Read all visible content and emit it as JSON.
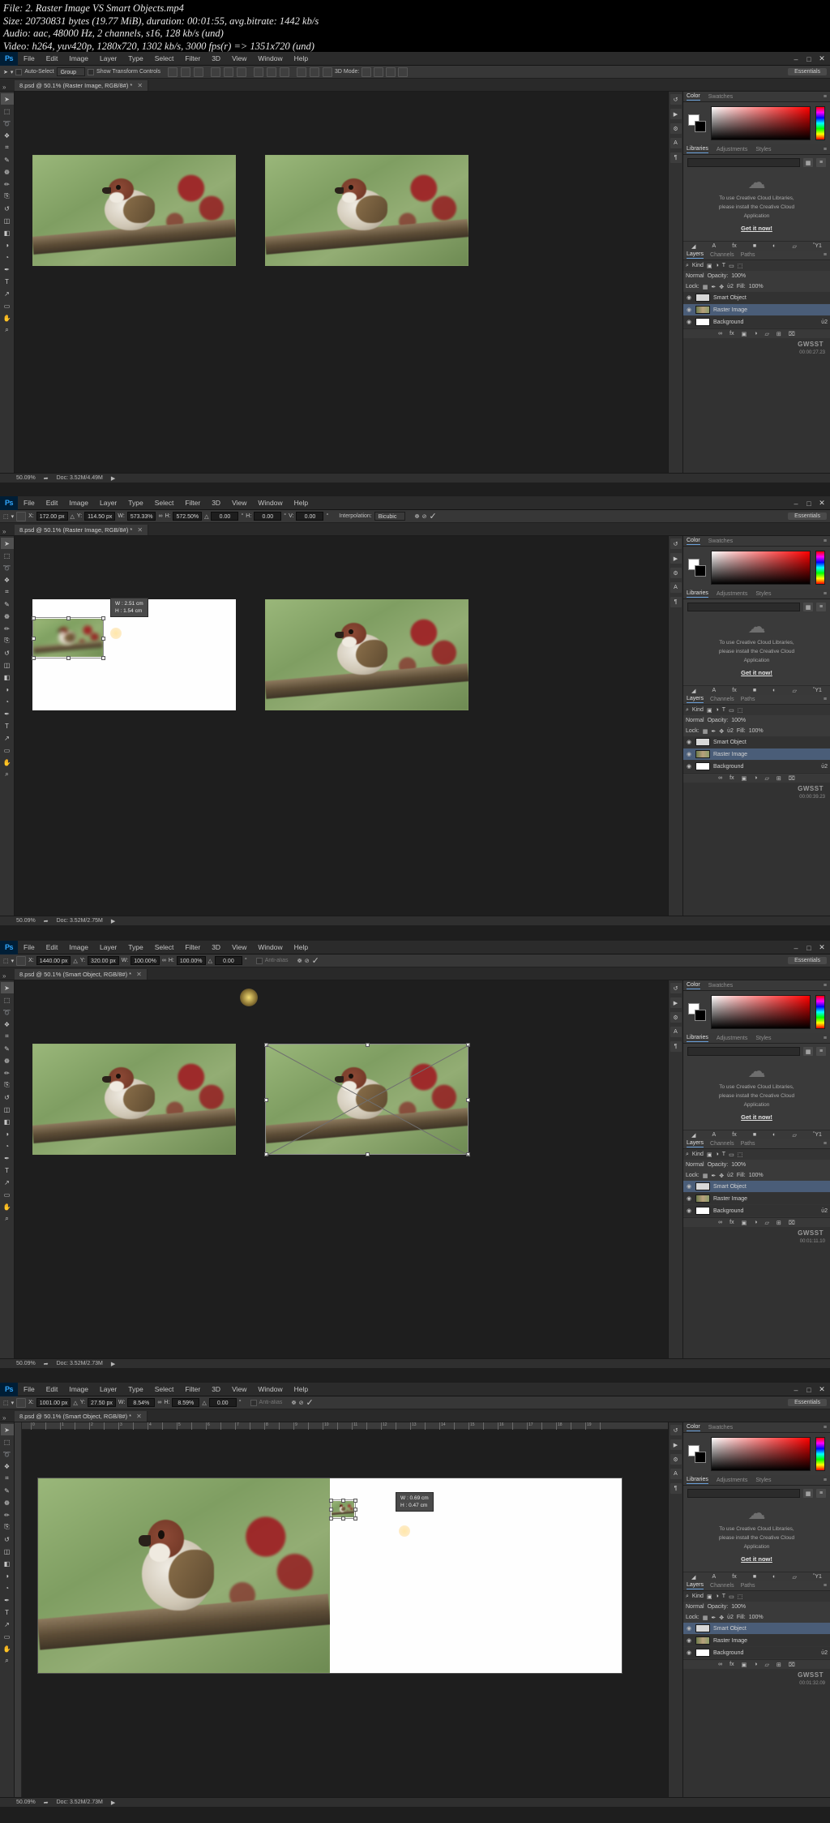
{
  "fileinfo": {
    "line1": "File: 2. Raster Image VS Smart Objects.mp4",
    "line2": "Size: 20730831 bytes (19.77 MiB), duration: 00:01:55, avg.bitrate: 1442 kb/s",
    "line3": "Audio: aac, 48000 Hz, 2 channels, s16, 128 kb/s (und)",
    "line4": "Video: h264, yuv420p, 1280x720, 1302 kb/s, 3000 fps(r) => 1351x720 (und)"
  },
  "menu": {
    "logo": "Ps",
    "items": [
      "File",
      "Edit",
      "Image",
      "Layer",
      "Type",
      "Select",
      "Filter",
      "3D",
      "View",
      "Window",
      "Help"
    ],
    "minimize": "–",
    "maximize": "□",
    "close": "✕"
  },
  "colors": {
    "accent": "#31a8ff",
    "selection": "#4a5d78",
    "panel_bg": "#323232",
    "canvas_bg": "#1e1e1e",
    "optbar_bg": "#373737"
  },
  "panel": {
    "color_tabs": [
      "Color",
      "Swatches"
    ],
    "lib_tabs": [
      "Libraries",
      "Adjustments",
      "Styles"
    ],
    "lib_message_1": "To use Creative Cloud Libraries,",
    "lib_message_2": "please install the Creative Cloud",
    "lib_message_3": "Application",
    "lib_link": "Get it now!",
    "layer_tabs": [
      "Layers",
      "Channels",
      "Paths"
    ],
    "kind_label": "Kind",
    "blend_mode": "Normal",
    "opacity_label": "Opacity:",
    "opacity_value": "100%",
    "lock_label": "Lock:",
    "fill_label": "Fill:",
    "fill_value": "100%",
    "watermark": "GWSST",
    "layers": [
      {
        "name": "Smart Object",
        "thumb": "so",
        "locked": false
      },
      {
        "name": "Raster Image",
        "thumb": "raster",
        "locked": false
      },
      {
        "name": "Background",
        "thumb": "white",
        "locked": true
      }
    ]
  },
  "windows": [
    {
      "id": "win1",
      "tab_title": "8.psd @ 50.1% (Raster Image, RGB/8#) *",
      "optionsbar": {
        "type": "move",
        "auto_select_label": "Auto-Select",
        "auto_select_value": "Group",
        "transform_controls_label": "Show Transform Controls",
        "mode_3d_label": "3D Mode:",
        "workspace": "Essentials"
      },
      "status": {
        "zoom": "50.09%",
        "doc": "Doc: 3.52M/4.49M"
      },
      "selected_layer_index": 1,
      "timecode": "00:00:27.23",
      "tooltip": null
    },
    {
      "id": "win2",
      "tab_title": "8.psd @ 50.1% (Raster Image, RGB/8#) *",
      "optionsbar": {
        "type": "transform",
        "x_label": "X:",
        "x_value": "172.00 px",
        "y_label": "Y:",
        "y_value": "114.50 px",
        "w_label": "W:",
        "w_value": "573.33%",
        "link": "∞",
        "h_label": "H:",
        "h_value": "572.50%",
        "angle_label": "△",
        "angle_value": "0.00",
        "skew_h_label": "H:",
        "skew_h_value": "0.00",
        "skew_v_label": "V:",
        "skew_v_value": "0.00",
        "interp_label": "Interpolation:",
        "interp_value": "Bicubic",
        "workspace": "Essentials"
      },
      "status": {
        "zoom": "50.09%",
        "doc": "Doc: 3.52M/2.75M"
      },
      "selected_layer_index": 1,
      "timecode": "00:00:39.23",
      "tooltip": {
        "w": "W :  2.51 cm",
        "h": "H :  1.54 cm"
      }
    },
    {
      "id": "win3",
      "tab_title": "8.psd @ 50.1% (Smart Object, RGB/8#) *",
      "optionsbar": {
        "type": "transform",
        "x_label": "X:",
        "x_value": "1440.00 px",
        "y_label": "Y:",
        "y_value": "320.00 px",
        "w_label": "W:",
        "w_value": "100.00%",
        "link": "∞",
        "h_label": "H:",
        "h_value": "100.00%",
        "angle_label": "△",
        "angle_value": "0.00",
        "antialias_label": "Anti-alias",
        "workspace": "Essentials"
      },
      "status": {
        "zoom": "50.09%",
        "doc": "Doc: 3.52M/2.73M"
      },
      "selected_layer_index": 0,
      "timecode": "00:01:11.10",
      "tooltip": null
    },
    {
      "id": "win4",
      "tab_title": "8.psd @ 50.1% (Smart Object, RGB/8#) *",
      "optionsbar": {
        "type": "transform",
        "x_label": "X:",
        "x_value": "1001.00 px",
        "y_label": "Y:",
        "y_value": "27.50 px",
        "w_label": "W:",
        "w_value": "8.54%",
        "link": "∞",
        "h_label": "H:",
        "h_value": "8.59%",
        "angle_label": "△",
        "angle_value": "0.00",
        "antialias_label": "Anti-alias",
        "workspace": "Essentials"
      },
      "status": {
        "zoom": "50.09%",
        "doc": "Doc: 3.52M/2.73M"
      },
      "selected_layer_index": 0,
      "timecode": "00:01:32.09",
      "tooltip": {
        "w": "W :  0.69 cm",
        "h": "H :  0.47 cm"
      }
    }
  ],
  "tools": [
    "move-tool",
    "marquee-tool",
    "lasso-tool",
    "quick-select-tool",
    "crop-tool",
    "eyedropper-tool",
    "healing-brush-tool",
    "brush-tool",
    "clone-stamp-tool",
    "history-brush-tool",
    "eraser-tool",
    "gradient-tool",
    "blur-tool",
    "dodge-tool",
    "pen-tool",
    "type-tool",
    "path-select-tool",
    "shape-tool",
    "hand-tool",
    "zoom-tool"
  ],
  "tool_glyphs": [
    "➤",
    "⬚",
    "➰",
    "❖",
    "⌗",
    "✎",
    "❁",
    "✏",
    "⎘",
    "↺",
    "◫",
    "◧",
    "◑",
    "◔",
    "✒",
    "T",
    "↗",
    "▭",
    "✋",
    "⌕"
  ]
}
